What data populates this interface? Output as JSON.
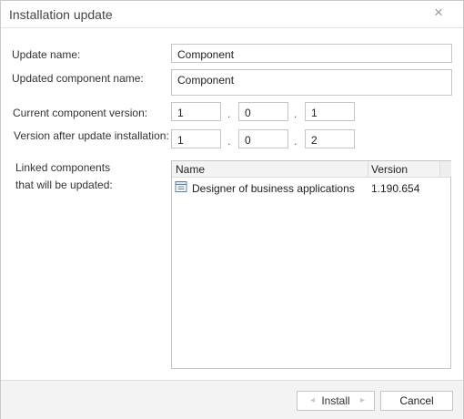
{
  "dialog": {
    "title": "Installation update",
    "close_glyph": "×"
  },
  "form": {
    "update_name_label": "Update name:",
    "update_name_value": "Component",
    "updated_component_label": "Updated component name:",
    "updated_component_value": "Component",
    "current_version_label": "Current component version:",
    "current_version": [
      "1",
      "0",
      "1"
    ],
    "new_version_label": "Version after update installation:",
    "new_version": [
      "1",
      "0",
      "2"
    ],
    "version_separator": ".",
    "linked_label_line1": "Linked components",
    "linked_label_line2": "that will be updated:"
  },
  "linked_grid": {
    "columns": [
      "Name",
      "Version"
    ],
    "rows": [
      {
        "name": "Designer of business applications",
        "version": "1.190.654",
        "icon": "component-package-icon"
      }
    ]
  },
  "footer": {
    "install_label": "Install",
    "cancel_label": "Cancel"
  },
  "colors": {
    "border": "#c5c5c5",
    "footer_bg": "#f3f3f3",
    "header_bg": "#f3f3f3",
    "icon_accent": "#5b7fa6"
  }
}
